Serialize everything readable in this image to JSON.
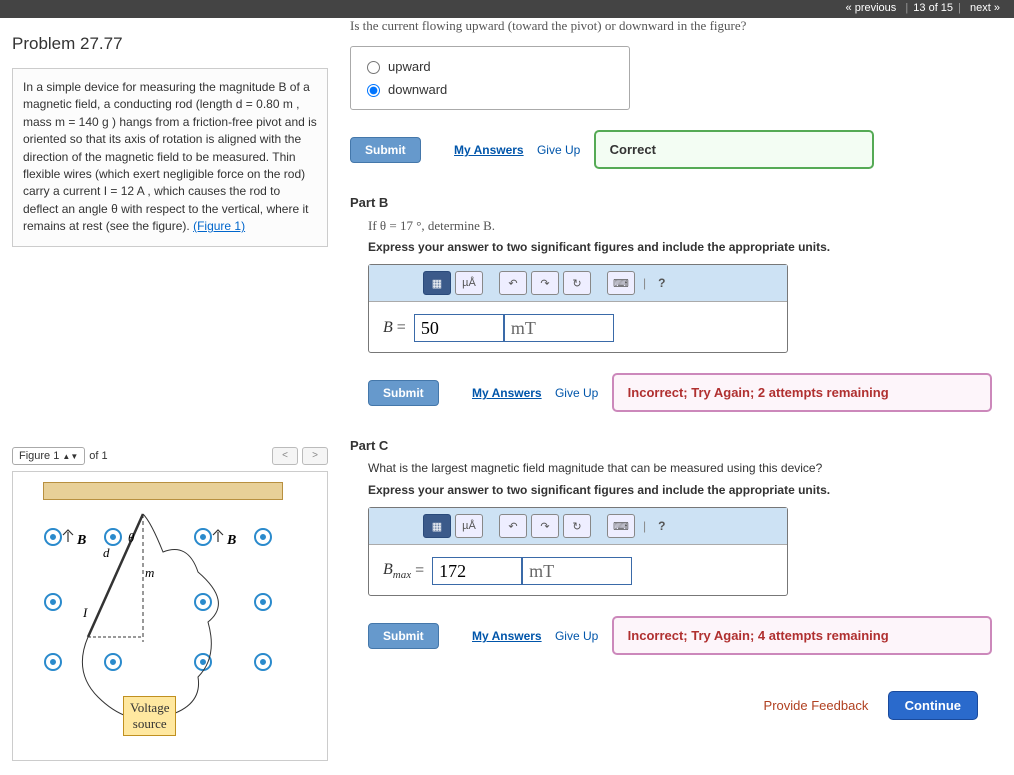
{
  "nav": {
    "prev": "« previous",
    "pos": "13 of 15",
    "next": "next »"
  },
  "problem": {
    "title": "Problem 27.77"
  },
  "description": "In a simple device for measuring the magnitude B of a magnetic field, a conducting rod (length d = 0.80 m , mass m = 140 g ) hangs from a friction-free pivot and is oriented so that its axis of rotation is aligned with the direction of the magnetic field to be measured. Thin flexible wires (which exert negligible force on the rod) carry a current I = 12 A , which causes the rod to deflect an angle θ with respect to the vertical, where it remains at rest (see the figure).",
  "fig_link": "(Figure 1)",
  "figure": {
    "label": "Figure 1",
    "of": "of 1",
    "voltage": "Voltage\nsource"
  },
  "partA": {
    "question": "Is the current flowing upward (toward the pivot) or downward in the figure?",
    "opt1": "upward",
    "opt2": "downward",
    "submit": "Submit",
    "myans": "My Answers",
    "giveup": "Give Up",
    "feedback": "Correct"
  },
  "partB": {
    "title": "Part B",
    "q": "If θ = 17 °, determine B.",
    "instr": "Express your answer to two significant figures and include the appropriate units.",
    "var": "B",
    "val": "50",
    "unit": "mT",
    "submit": "Submit",
    "myans": "My Answers",
    "giveup": "Give Up",
    "feedback": "Incorrect; Try Again; 2 attempts remaining"
  },
  "partC": {
    "title": "Part C",
    "q": "What is the largest magnetic field magnitude that can be measured using this device?",
    "instr": "Express your answer to two significant figures and include the appropriate units.",
    "var": "Bmax",
    "val": "172",
    "unit": "mT",
    "submit": "Submit",
    "myans": "My Answers",
    "giveup": "Give Up",
    "feedback": "Incorrect; Try Again; 4 attempts remaining"
  },
  "footer": {
    "feedback": "Provide Feedback",
    "cont": "Continue"
  },
  "tool": {
    "units": "µÅ",
    "help": "?"
  }
}
